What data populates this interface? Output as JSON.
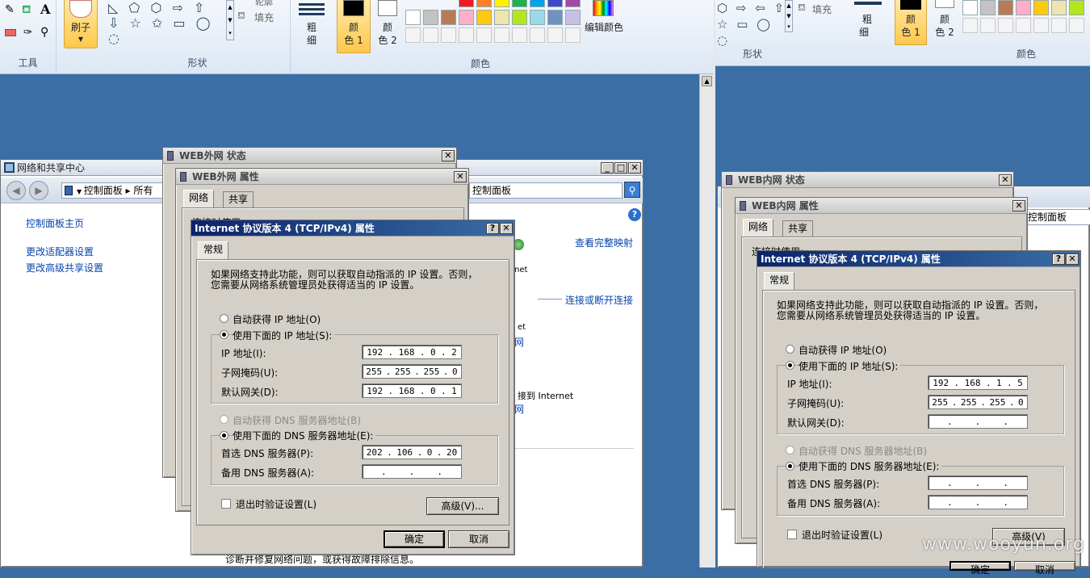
{
  "ribbon_left": {
    "groups": {
      "tools": "工具",
      "shapes": "形状",
      "colors": "颜色"
    },
    "brush": "刷子",
    "outline": "轮廓",
    "fill": "填充",
    "size": [
      "粗",
      "细"
    ],
    "color1": [
      "颜",
      "色 1"
    ],
    "color2": [
      "颜",
      "色 2"
    ],
    "edit_colors": "编辑颜色"
  },
  "ribbon_right": {
    "fill": "填充",
    "shapes": "形状",
    "colors": "颜色",
    "size": [
      "粗",
      "细"
    ],
    "color1": [
      "颜",
      "色 1"
    ],
    "color2": [
      "颜",
      "色 2"
    ]
  },
  "palette_colors": [
    "#ffffff",
    "#c3c3c3",
    "#b97a57",
    "#ffaec9",
    "#ffc90e",
    "#efe4b0",
    "#b5e61d",
    "#99d9ea",
    "#7092be",
    "#c8bfe7"
  ],
  "palette_top_colors": [
    "#ed1c24",
    "#ff7f27",
    "#fff200",
    "#22b14c",
    "#00a2e8",
    "#3f48cc",
    "#a349a4"
  ],
  "left": {
    "nsc_title": "网络和共享中心",
    "nsc_address": "控制面板",
    "nsc_address_more": "所有",
    "nsc_address_right": "控制面板",
    "nsc_links": [
      "控制面板主页",
      "更改适配器设置",
      "更改高级共享设置"
    ],
    "nsc_right_links": [
      "查看完整映射",
      "连接或断开连接"
    ],
    "nsc_fragments": [
      "net",
      "et",
      "网",
      "接到 Internet",
      "网"
    ],
    "nsc_bottom": "诊断并修复网络问题，或获得故障排除信息。",
    "status_title": "WEB外网 状态",
    "props_title": "WEB外网 属性",
    "props_tabs": [
      "网络",
      "共享"
    ],
    "props_partial": "连接时使用:",
    "ipv4": {
      "title": "Internet 协议版本 4 (TCP/IPv4) 属性",
      "tab": "常规",
      "intro": [
        "如果网络支持此功能，则可以获取自动指派的 IP 设置。否则，",
        "您需要从网络系统管理员处获得适当的 IP 设置。"
      ],
      "auto_ip": "自动获得 IP 地址(O)",
      "manual_ip": "使用下面的 IP 地址(S):",
      "ip_label": "IP 地址(I):",
      "mask_label": "子网掩码(U):",
      "gw_label": "默认网关(D):",
      "ip": [
        "192",
        "168",
        "0",
        "2"
      ],
      "mask": [
        "255",
        "255",
        "255",
        "0"
      ],
      "gw": [
        "192",
        "168",
        "0",
        "1"
      ],
      "auto_dns": "自动获得 DNS 服务器地址(B)",
      "manual_dns": "使用下面的 DNS 服务器地址(E):",
      "dns1_label": "首选 DNS 服务器(P):",
      "dns2_label": "备用 DNS 服务器(A):",
      "dns1": [
        "202",
        "106",
        "0",
        "20"
      ],
      "dns2": [
        "",
        "",
        "",
        ""
      ],
      "validate": "退出时验证设置(L)",
      "advanced": "高级(V)...",
      "ok": "确定",
      "cancel": "取消"
    }
  },
  "right": {
    "status_title": "WEB内网 状态",
    "props_title": "WEB内网 属性",
    "props_tabs": [
      "网络",
      "共享"
    ],
    "props_partial": "连接时使用:",
    "addr_fragment": "控制面板",
    "ipv4": {
      "title": "Internet 协议版本 4 (TCP/IPv4) 属性",
      "tab": "常规",
      "intro": [
        "如果网络支持此功能，则可以获取自动指派的 IP 设置。否则，",
        "您需要从网络系统管理员处获得适当的 IP 设置。"
      ],
      "auto_ip": "自动获得 IP 地址(O)",
      "manual_ip": "使用下面的 IP 地址(S):",
      "ip_label": "IP 地址(I):",
      "mask_label": "子网掩码(U):",
      "gw_label": "默认网关(D):",
      "ip": [
        "192",
        "168",
        "1",
        "5"
      ],
      "mask": [
        "255",
        "255",
        "255",
        "0"
      ],
      "gw": [
        "",
        "",
        "",
        ""
      ],
      "auto_dns": "自动获得 DNS 服务器地址(B)",
      "manual_dns": "使用下面的 DNS 服务器地址(E):",
      "dns1_label": "首选 DNS 服务器(P):",
      "dns2_label": "备用 DNS 服务器(A):",
      "dns1": [
        "",
        "",
        "",
        ""
      ],
      "dns2": [
        "",
        "",
        "",
        ""
      ],
      "validate": "退出时验证设置(L)",
      "advanced": "高级(V)",
      "ok": "确定",
      "cancel": "取消"
    }
  },
  "watermark": "www.wooyun.org"
}
